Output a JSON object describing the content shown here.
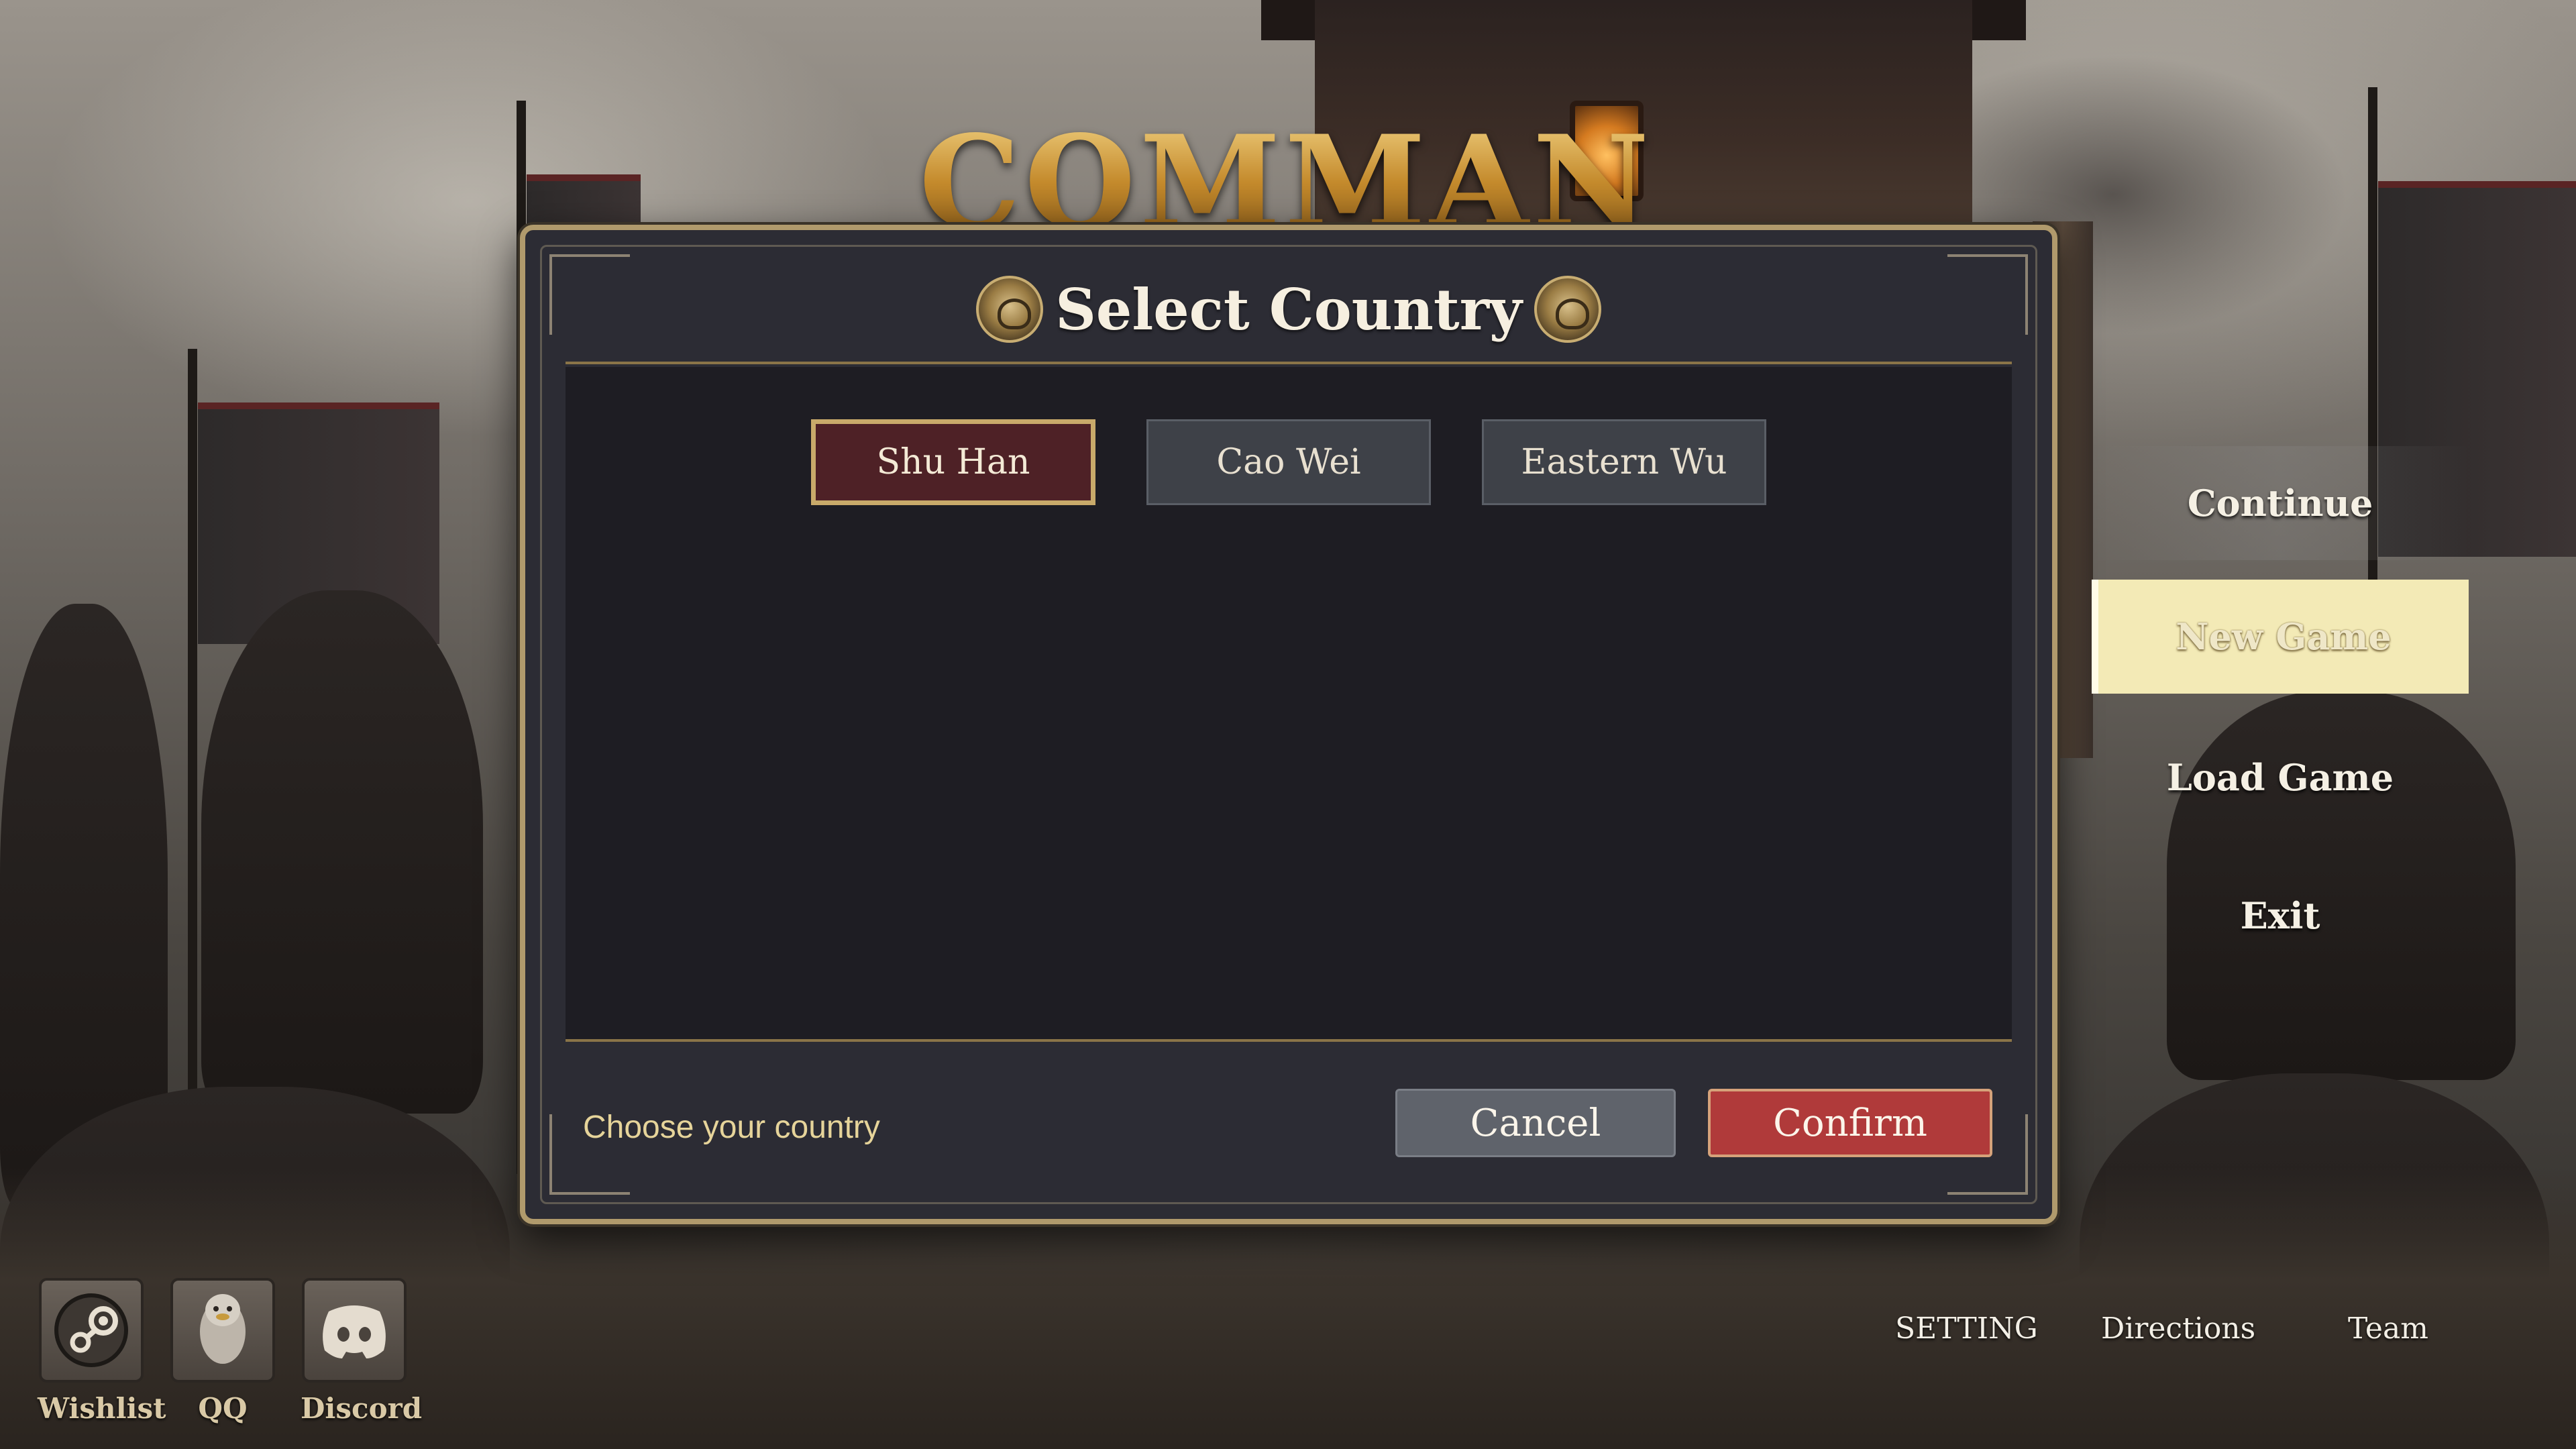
{
  "game": {
    "logo_text": "COMMAND"
  },
  "dialog": {
    "title": "Select Country",
    "countries": [
      {
        "label": "Shu Han",
        "selected": true
      },
      {
        "label": "Cao Wei",
        "selected": false
      },
      {
        "label": "Eastern Wu",
        "selected": false
      }
    ],
    "hint": "Choose your country",
    "cancel_label": "Cancel",
    "confirm_label": "Confirm"
  },
  "main_menu": {
    "items": [
      {
        "label": "Continue"
      },
      {
        "label": "New Game",
        "highlighted": true
      },
      {
        "label": "Load Game"
      },
      {
        "label": "Exit"
      }
    ]
  },
  "bottom_links": {
    "setting": "SETTING",
    "directions": "Directions",
    "team": "Team"
  },
  "social": [
    {
      "label": "Wishlist",
      "icon": "steam-icon"
    },
    {
      "label": "QQ",
      "icon": "qq-penguin-icon"
    },
    {
      "label": "Discord",
      "icon": "discord-icon"
    }
  ],
  "colors": {
    "selected_country_bg": "#4e2126",
    "selected_country_border": "#c9aa6a",
    "confirm_bg": "#b03a3a",
    "cancel_bg": "#5f636b",
    "hint_text": "#e6d49a",
    "highlight_menu_bg": "#f3eab6"
  }
}
